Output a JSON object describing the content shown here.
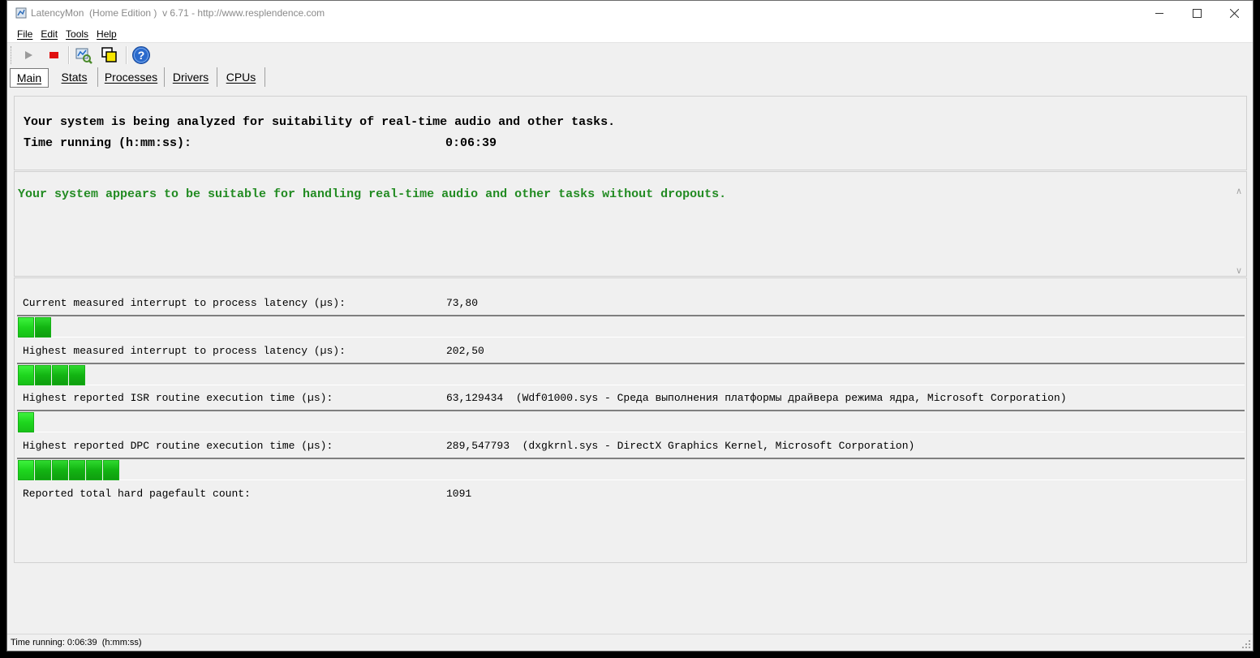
{
  "window": {
    "title": "LatencyMon  (Home Edition )  v 6.71 - http://www.resplendence.com"
  },
  "menu": [
    "File",
    "Edit",
    "Tools",
    "Help"
  ],
  "toolbar": {
    "icons": [
      "play-icon",
      "stop-icon",
      "analyze-icon",
      "windows-icon",
      "help-icon"
    ]
  },
  "tabs": [
    "Main",
    "Stats",
    "Processes",
    "Drivers",
    "CPUs"
  ],
  "active_tab": "Main",
  "status_panel": {
    "line1": "Your system is being analyzed for suitability of real-time audio and other tasks.",
    "time_label": "Time running (h:mm:ss):",
    "time_value": "0:06:39"
  },
  "conclusion": {
    "text": "Your system appears to be suitable for handling real-time audio and other tasks without dropouts.",
    "color": "#228b22"
  },
  "metrics": [
    {
      "label": "Current measured interrupt to process latency (µs):",
      "value": "73,80",
      "bar_segments": 2
    },
    {
      "label": "Highest measured interrupt to process latency (µs):",
      "value": "202,50",
      "bar_segments": 4
    },
    {
      "label": "Highest reported ISR routine execution time (µs):",
      "value": "63,129434  (Wdf01000.sys - Среда выполнения платформы драйвера режима ядра, Microsoft Corporation)",
      "bar_segments": 1
    },
    {
      "label": "Highest reported DPC routine execution time (µs):",
      "value": "289,547793  (dxgkrnl.sys - DirectX Graphics Kernel, Microsoft Corporation)",
      "bar_segments": 6
    },
    {
      "label": "Reported total hard pagefault count:",
      "value": "1091"
    }
  ],
  "statusbar": {
    "text": "Time running: 0:06:39  (h:mm:ss)"
  }
}
